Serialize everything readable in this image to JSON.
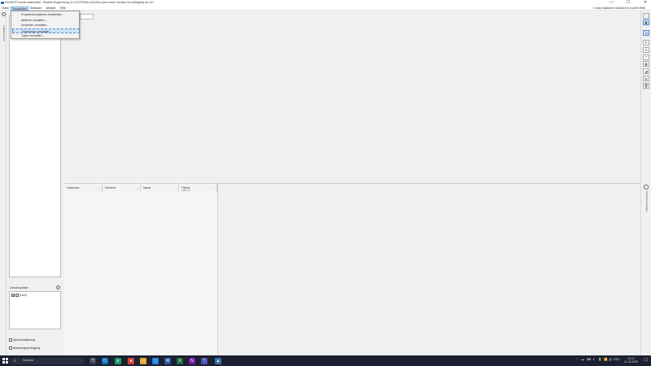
{
  "window": {
    "title": "20230227-soinik-testmodell - Rovinis Engineering 11.10.0-RTMh-c33c7fca (eine neue Version ist verfügbar) de-CH",
    "minimize": "—",
    "maximize": "☐",
    "close": "✕"
  },
  "menubar": {
    "items": [
      "Datei",
      "Bearbeiten",
      "Gebäude",
      "Ansicht",
      "Hilfe"
    ],
    "map_info": "0 map instances included in current filter."
  },
  "dropdown": {
    "items": [
      "Projektinformationen bearbeiten...",
      "Attribute verwalten...",
      "Ansichten verwalten...",
      "Geschosse verwalten...",
      "Typen verwalten..."
    ],
    "highlighted_index": 3
  },
  "left_rail": {
    "toggle": "‹",
    "label": "Projektbrowser"
  },
  "left_panel": {
    "geschossfilter_label": "Geschossfilter",
    "add_icon": "+",
    "filter_rows": [
      {
        "label": "(Leer)",
        "checked": true
      }
    ],
    "option_sync": "Synchronisierung",
    "option_tracking": "Änderungsverfolgung"
  },
  "table": {
    "columns": [
      {
        "label": "Geschoss",
        "sub": ""
      },
      {
        "label": "Nummer",
        "sub": ""
      },
      {
        "label": "Name",
        "sub": ""
      },
      {
        "label": "Fläche",
        "sub": "(GRE m²)"
      }
    ],
    "chevron": "⌄"
  },
  "right_rail": {
    "tools": [
      "⋮⋮",
      "▣",
      "⇲",
      "✎",
      "⌖",
      "⌃",
      "▦",
      "◢",
      "▤",
      "🗑"
    ],
    "toggle": "‹",
    "label": "Elemente anzeigen"
  },
  "taskbar": {
    "search_icon": "⌕",
    "search_placeholder": "Suchen",
    "apps": [
      {
        "name": "task-view",
        "glyph": "❐",
        "color": "#3a3f52"
      },
      {
        "name": "outlook",
        "glyph": "O",
        "color": "#0f6cbd"
      },
      {
        "name": "edge",
        "glyph": "e",
        "color": "#1a9e6c"
      },
      {
        "name": "chrome",
        "glyph": "●",
        "color": "#d6443a"
      },
      {
        "name": "explorer",
        "glyph": "▭",
        "color": "#e0a82e"
      },
      {
        "name": "vscode",
        "glyph": "⟩",
        "color": "#1e88e5"
      },
      {
        "name": "word",
        "glyph": "W",
        "color": "#2b579a"
      },
      {
        "name": "excel",
        "glyph": "X",
        "color": "#1d6f42"
      },
      {
        "name": "onenote",
        "glyph": "N",
        "color": "#7719aa"
      },
      {
        "name": "teams",
        "glyph": "T",
        "color": "#4b53bc"
      },
      {
        "name": "record",
        "glyph": "●",
        "color": "#b3261e"
      },
      {
        "name": "rovinis",
        "glyph": "▲",
        "color": "#3b6ea5"
      }
    ],
    "tray_icons": [
      "⌃",
      "☁",
      "⌨",
      "✦",
      "🔋",
      "📶",
      "🔊"
    ],
    "language": "DEU",
    "time": "10:12",
    "date": "21.03.2025",
    "notification_icon": "🗨"
  }
}
